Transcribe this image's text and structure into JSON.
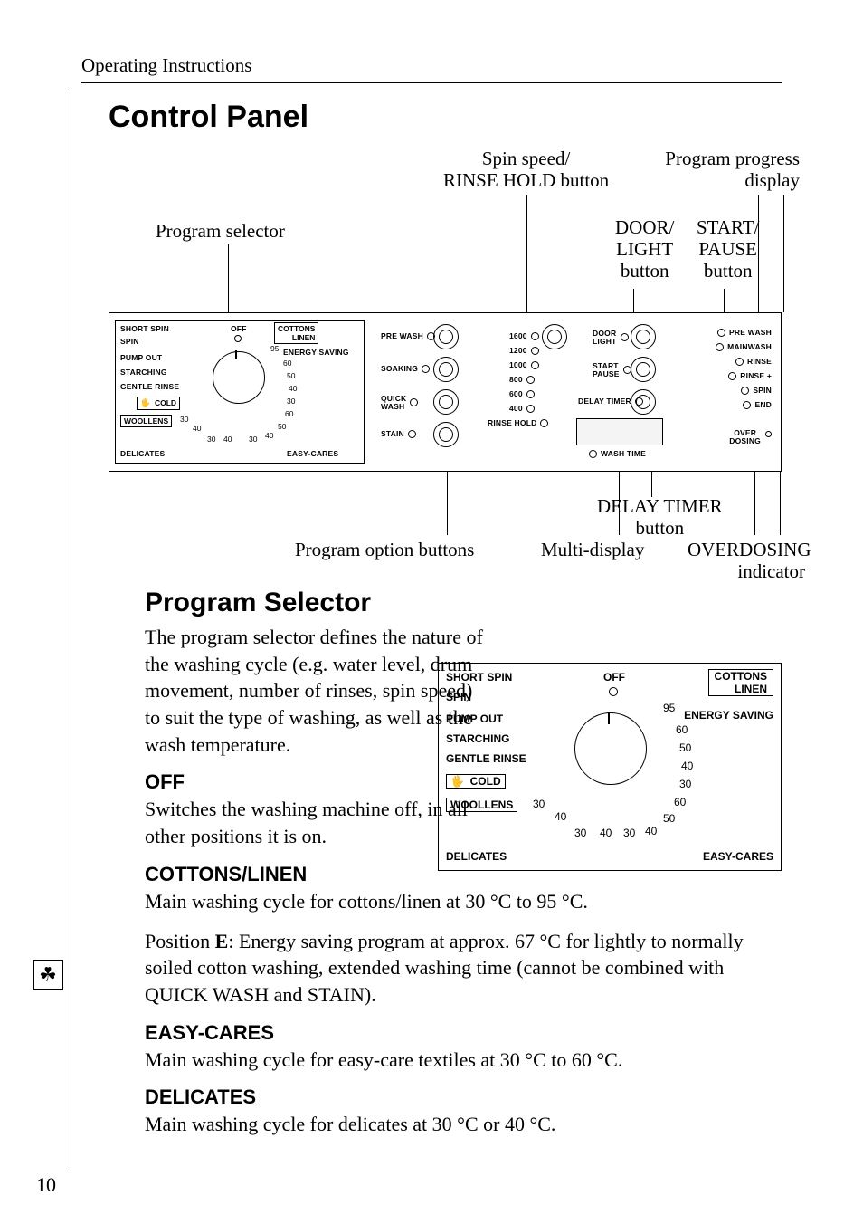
{
  "page": {
    "running_head": "Operating Instructions",
    "number": "10"
  },
  "control_panel": {
    "title": "Control Panel",
    "callouts": {
      "program_selector": "Program selector",
      "spin": "Spin speed/\nRINSE HOLD button",
      "progress": "Program progress\ndisplay",
      "door": "DOOR/\nLIGHT\nbutton",
      "start": "START/\nPAUSE\nbutton",
      "delay": "DELAY TIMER\nbutton",
      "options": "Program option buttons",
      "multi": "Multi-display",
      "over": "OVERDOSING\nindicator"
    },
    "dial": {
      "off": "OFF",
      "cottons": "COTTONS\nLINEN",
      "energy": "ENERGY SAVING",
      "temps_right": [
        "95",
        "60",
        "50",
        "40",
        "30"
      ],
      "easy": "EASY-CARES",
      "easy_temps": [
        "60",
        "50",
        "40",
        "30"
      ],
      "delicates": "DELICATES",
      "del_temps": [
        "40",
        "30"
      ],
      "woollens": "WOOLLENS",
      "wool_temps": [
        "40",
        "30"
      ],
      "cold": "COLD",
      "gentle": "GENTLE RINSE",
      "starching": "STARCHING",
      "pumpout": "PUMP OUT",
      "spin": "SPIN",
      "shortspin": "SHORT SPIN"
    },
    "option_buttons": [
      "PRE WASH",
      "SOAKING",
      "QUICK\nWASH",
      "STAIN"
    ],
    "spin_speeds": [
      "1600",
      "1200",
      "1000",
      "800",
      "600",
      "400",
      "RINSE HOLD"
    ],
    "right_buttons": {
      "door": "DOOR\nLIGHT",
      "startpause": "START\nPAUSE",
      "delay": "DELAY TIMER",
      "wash_time": "WASH TIME"
    },
    "progress_leds": [
      "PRE WASH",
      "MAINWASH",
      "RINSE",
      "RINSE +",
      "SPIN",
      "END"
    ],
    "overdosing": "OVER\nDOSING"
  },
  "program_selector": {
    "title": "Program Selector",
    "intro": "The program selector defines the nature of the washing cycle (e.g. water level, drum movement, number of rinses, spin speed) to suit the type of washing, as well as the wash temperature.",
    "off": {
      "heading": "OFF",
      "text": "Switches the washing machine off, in all other positions it is on."
    },
    "cottons": {
      "heading": "COTTONS/LINEN",
      "text": "Main washing cycle for cottons/linen at 30 °C to 95 °C.",
      "tip_prefix": "Position ",
      "tip_bold": "E",
      "tip_rest": ": Energy saving program at approx. 67 °C for lightly to normally soiled cotton washing, extended washing time (cannot be combined with QUICK WASH and STAIN)."
    },
    "easy": {
      "heading": "EASY-CARES",
      "text": "Main washing cycle for easy-care textiles at 30 °C to 60 °C."
    },
    "delicates": {
      "heading": "DELICATES",
      "text": "Main washing cycle for delicates at 30 °C or 40 °C."
    }
  }
}
